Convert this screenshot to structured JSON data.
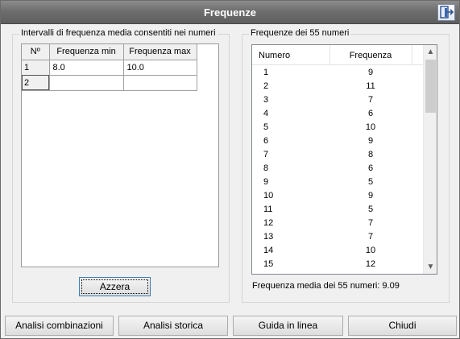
{
  "window": {
    "title": "Frequenze",
    "exit_icon": "exit-door-icon"
  },
  "left_group": {
    "title": "Intervalli di frequenza media consentiti nei numeri",
    "grid": {
      "headers": [
        "Nº",
        "Frequenza min",
        "Frequenza max"
      ],
      "rows": [
        {
          "n": "1",
          "min": "8.0",
          "max": "10.0"
        },
        {
          "n": "2",
          "min": "",
          "max": ""
        }
      ]
    },
    "reset_label": "Azzera"
  },
  "right_group": {
    "title": "Frequenze dei 55 numeri",
    "columns": [
      "Numero",
      "Frequenza"
    ],
    "rows": [
      {
        "numero": "1",
        "frequenza": "9"
      },
      {
        "numero": "2",
        "frequenza": "11"
      },
      {
        "numero": "3",
        "frequenza": "7"
      },
      {
        "numero": "4",
        "frequenza": "6"
      },
      {
        "numero": "5",
        "frequenza": "10"
      },
      {
        "numero": "6",
        "frequenza": "9"
      },
      {
        "numero": "7",
        "frequenza": "8"
      },
      {
        "numero": "8",
        "frequenza": "6"
      },
      {
        "numero": "9",
        "frequenza": "5"
      },
      {
        "numero": "10",
        "frequenza": "9"
      },
      {
        "numero": "11",
        "frequenza": "5"
      },
      {
        "numero": "12",
        "frequenza": "7"
      },
      {
        "numero": "13",
        "frequenza": "7"
      },
      {
        "numero": "14",
        "frequenza": "10"
      },
      {
        "numero": "15",
        "frequenza": "12"
      }
    ],
    "average_text": "Frequenza media dei 55 numeri: 9.09"
  },
  "footer": {
    "buttons": [
      "Analisi combinazioni",
      "Analisi storica",
      "Guida in linea",
      "Chiudi"
    ]
  }
}
